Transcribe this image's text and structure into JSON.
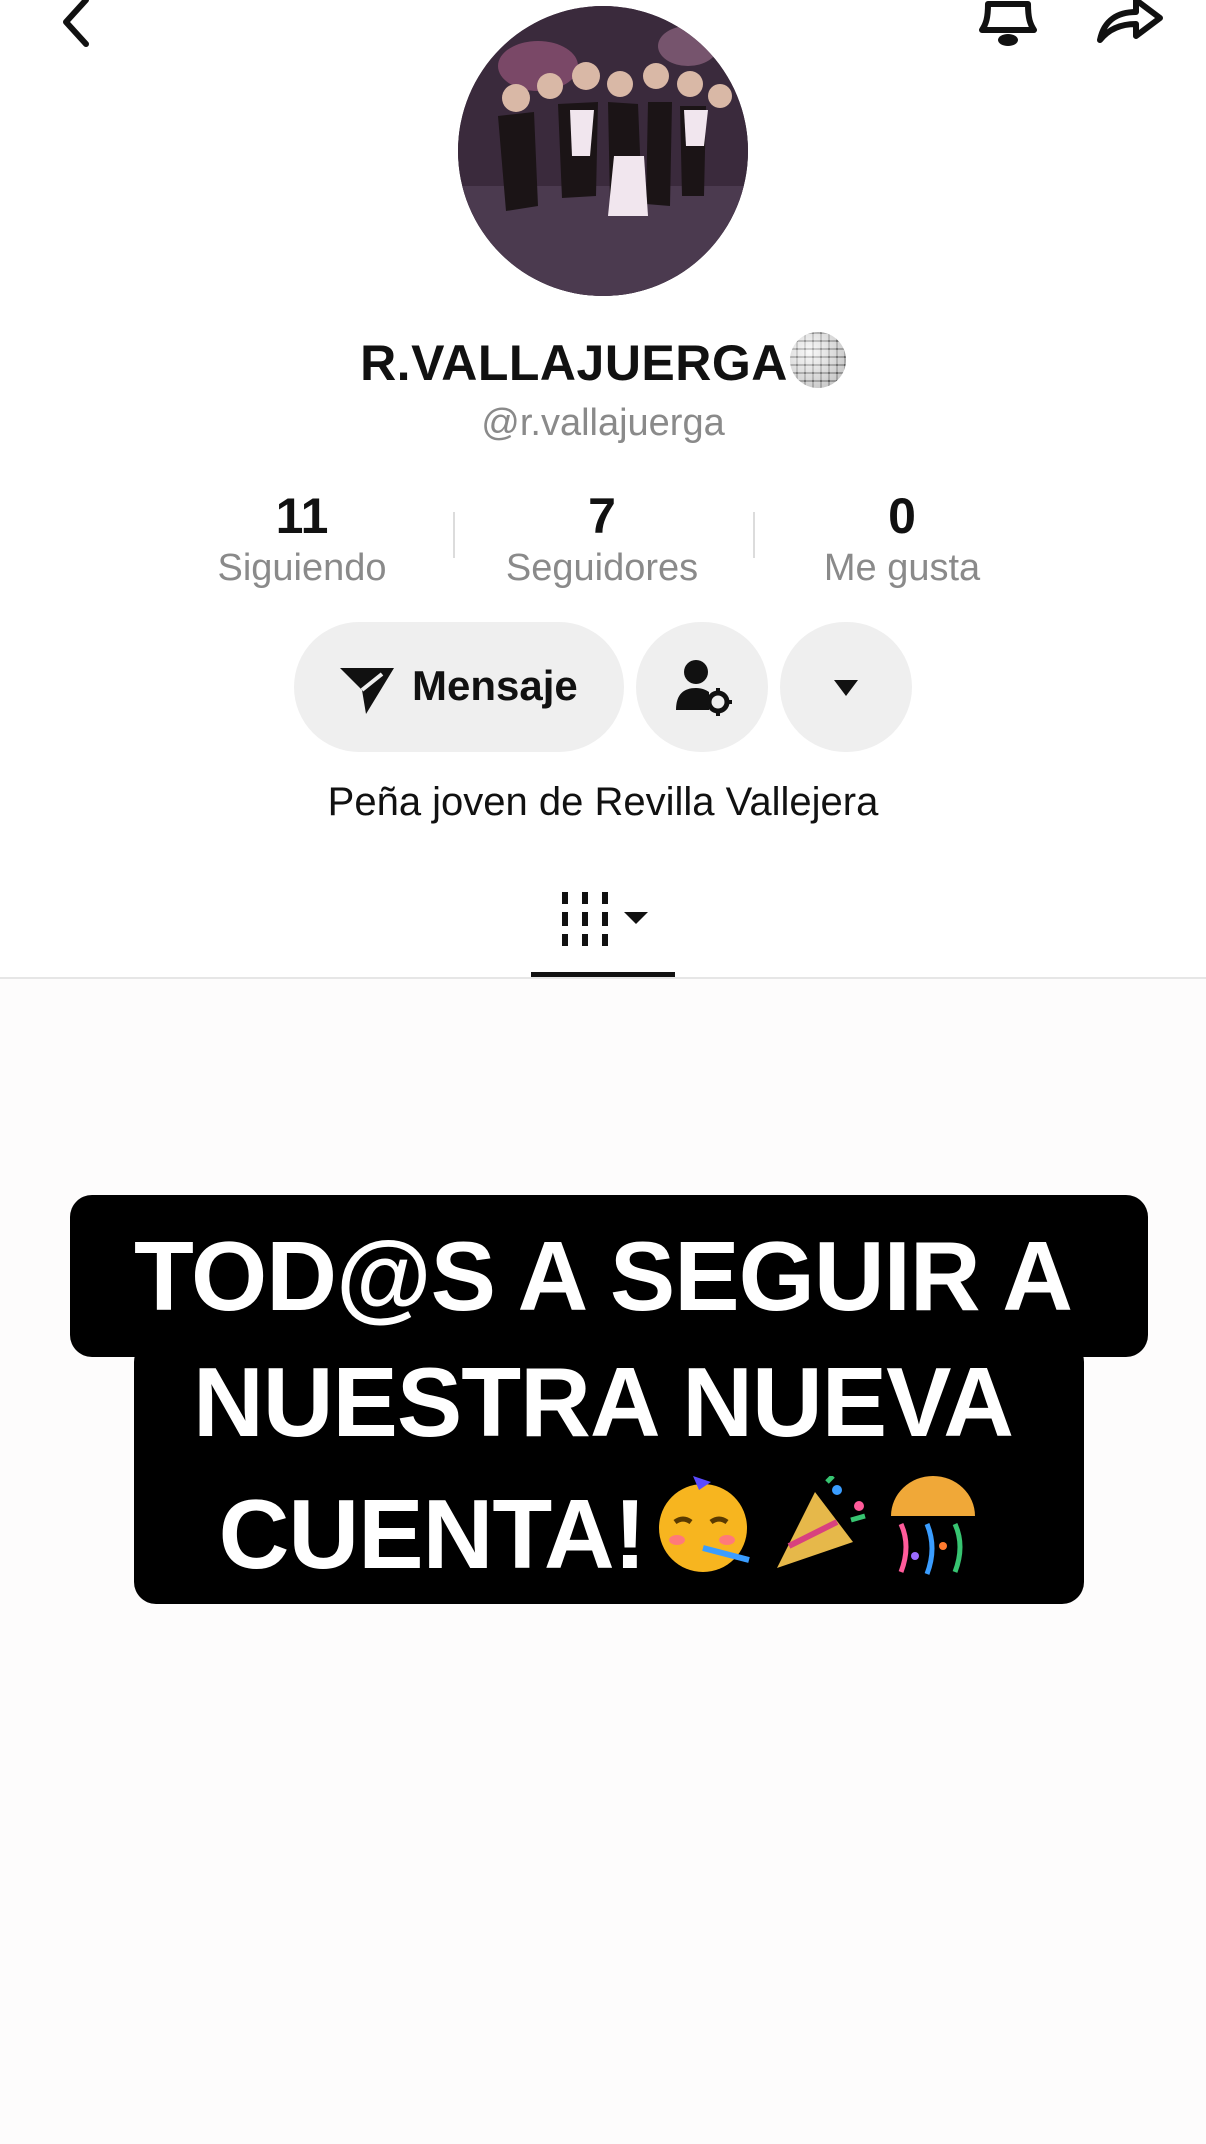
{
  "profile": {
    "display_name": "R.VALLAJUERGA",
    "username": "@r.vallajuerga",
    "bio": "Peña joven de Revilla Vallejera"
  },
  "stats": [
    {
      "value": "11",
      "label": "Siguiendo"
    },
    {
      "value": "7",
      "label": "Seguidores"
    },
    {
      "value": "0",
      "label": "Me gusta"
    }
  ],
  "actions": {
    "message_label": "Mensaje"
  },
  "post": {
    "lines": [
      "TOD@S A SEGUIR A",
      "NUESTRA NUEVA",
      "CUENTA!"
    ]
  },
  "icons": [
    "back-arrow-icon",
    "bell-icon",
    "share-icon",
    "send-icon",
    "person-settings-icon",
    "caret-down-icon",
    "grid-filter-icon",
    "disco-ball-icon",
    "party-face-emoji",
    "party-popper-emoji",
    "confetti-ball-emoji"
  ]
}
